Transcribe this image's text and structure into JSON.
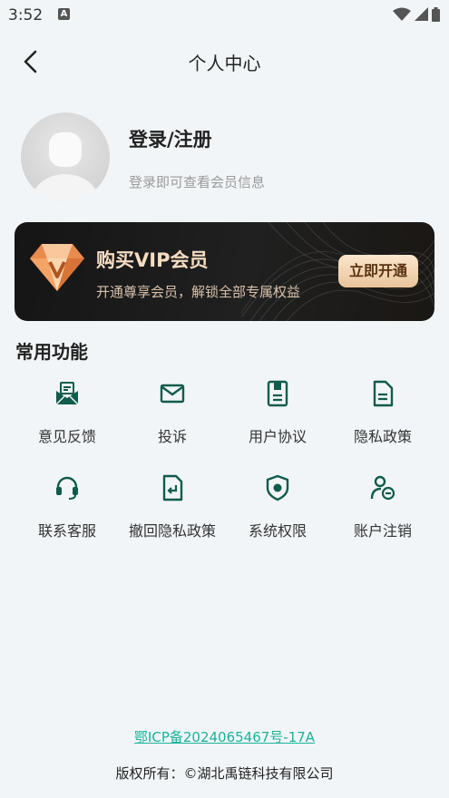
{
  "status_bar": {
    "time": "3:52",
    "notif_letter": "A",
    "icons": [
      "wifi-icon",
      "signal-icon",
      "battery-icon"
    ]
  },
  "header": {
    "title": "个人中心",
    "back_icon": "chevron-left-icon"
  },
  "profile": {
    "title": "登录/注册",
    "subtitle": "登录即可查看会员信息",
    "avatar_icon": "user-avatar-icon"
  },
  "vip": {
    "title": "购买VIP会员",
    "subtitle": "开通尊享会员，解锁全部专属权益",
    "button": "立即开通",
    "gem_icon": "diamond-icon",
    "colors": {
      "title": "#f6dcc2",
      "button_bg": "#f3d5b1",
      "card_bg": "#1b1b1b"
    }
  },
  "section": {
    "title": "常用功能"
  },
  "features": [
    {
      "label": "意见反馈",
      "icon": "feedback-mail-icon"
    },
    {
      "label": "投诉",
      "icon": "envelope-icon"
    },
    {
      "label": "用户协议",
      "icon": "agreement-doc-icon"
    },
    {
      "label": "隐私政策",
      "icon": "document-icon"
    },
    {
      "label": "联系客服",
      "icon": "headset-icon"
    },
    {
      "label": "撤回隐私政策",
      "icon": "revoke-doc-icon"
    },
    {
      "label": "系统权限",
      "icon": "shield-icon"
    },
    {
      "label": "账户注销",
      "icon": "user-cancel-icon"
    }
  ],
  "accent_color": "#0f5c4c",
  "footer": {
    "icp": "鄂ICP备2024065467号-17A",
    "copyright": "版权所有：©湖北禹链科技有限公司",
    "icp_color": "#19b39a"
  }
}
